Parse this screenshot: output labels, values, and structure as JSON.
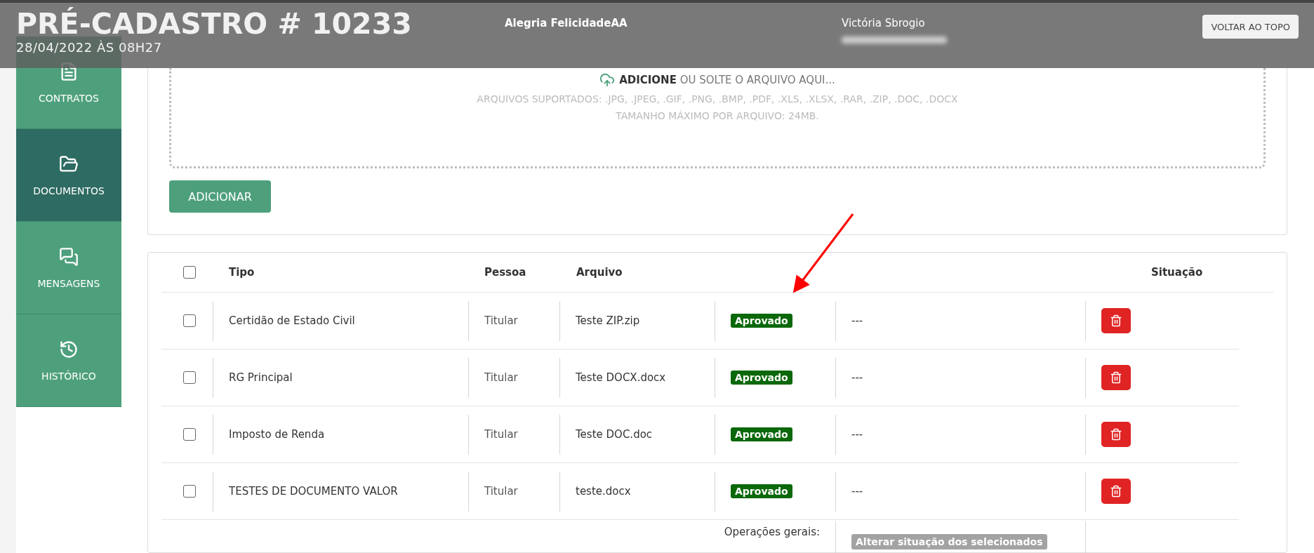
{
  "header": {
    "title": "PRÉ-CADASTRO # 10233",
    "date": "28/04/2022 ÀS 08H27",
    "client_name": "Alegria FelicidadeAA",
    "agent_name": "Victória Sbrogio",
    "top_button": "VOLTAR AO TOPO"
  },
  "sidebar": {
    "items": [
      {
        "kind": "contracts",
        "label": "CONTRATOS",
        "selected": false
      },
      {
        "kind": "documents",
        "label": "DOCUMENTOS",
        "selected": true
      },
      {
        "kind": "messages",
        "label": "MENSAGENS",
        "selected": false
      },
      {
        "kind": "history",
        "label": "HISTÓRICO",
        "selected": false
      }
    ]
  },
  "upload": {
    "drop_text": "**ADICIONE** OU SOLTE O ARQUIVO AQUI...",
    "supported": "ARQUIVOS SUPORTADOS: .JPG, .JPEG, .GIF, .PNG, .BMP, .PDF, .XLS, .XLSX, .RAR, .ZIP, .DOC, .DOCX",
    "max_size": "TAMANHO MÁXIMO POR ARQUIVO: 24MB.",
    "button": "ADICIONAR"
  },
  "table": {
    "select_all_checked": false,
    "columns": [
      "Tipo",
      "Pessoa",
      "Arquivo",
      "Situação"
    ],
    "rows": [
      {
        "checked": false,
        "tipo": "Certidão de Estado Civil",
        "pessoa": "Titular",
        "arquivo": "Teste ZIP.zip",
        "status": "Aprovado",
        "note": "---"
      },
      {
        "checked": false,
        "tipo": "RG Principal",
        "pessoa": "Titular",
        "arquivo": "Teste DOCX.docx",
        "status": "Aprovado",
        "note": "---"
      },
      {
        "checked": false,
        "tipo": "Imposto de Renda",
        "pessoa": "Titular",
        "arquivo": "Teste DOC.doc",
        "status": "Aprovado",
        "note": "---"
      },
      {
        "checked": false,
        "tipo": "TESTES DE DOCUMENTO VALOR",
        "pessoa": "Titular",
        "arquivo": "teste.docx",
        "status": "Aprovado",
        "note": "---"
      }
    ],
    "footer": {
      "label": "Operações gerais:",
      "button": "Alterar situação dos selecionados"
    }
  }
}
